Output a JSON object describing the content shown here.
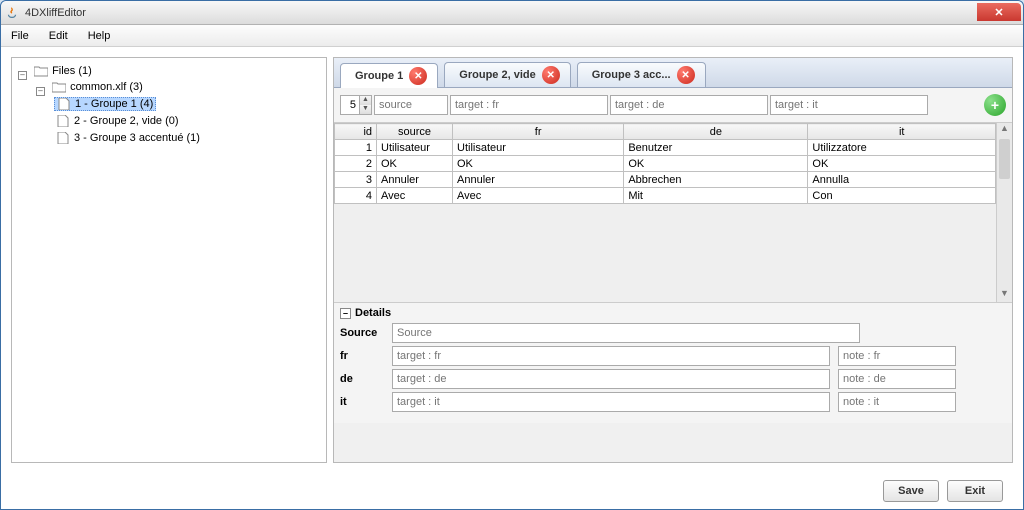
{
  "window": {
    "title": "4DXliffEditor"
  },
  "menu": {
    "file": "File",
    "edit": "Edit",
    "help": "Help"
  },
  "tree": {
    "root": "Files (1)",
    "file": "common.xlf (3)",
    "items": [
      "1 - Groupe 1 (4)",
      "2 - Groupe 2, vide (0)",
      "3 - Groupe 3 accentué (1)"
    ]
  },
  "tabs": [
    {
      "label": "Groupe 1"
    },
    {
      "label": "Groupe 2, vide"
    },
    {
      "label": "Groupe 3 acc..."
    }
  ],
  "inputRow": {
    "spinner": "5",
    "placeholders": {
      "source": "source",
      "fr": "target : fr",
      "de": "target : de",
      "it": "target : it"
    }
  },
  "grid": {
    "headers": {
      "id": "id",
      "source": "source",
      "fr": "fr",
      "de": "de",
      "it": "it"
    },
    "rows": [
      {
        "id": "1",
        "source": "Utilisateur",
        "fr": "Utilisateur",
        "de": "Benutzer",
        "it": "Utilizzatore"
      },
      {
        "id": "2",
        "source": "OK",
        "fr": "OK",
        "de": "OK",
        "it": "OK"
      },
      {
        "id": "3",
        "source": "Annuler",
        "fr": "Annuler",
        "de": "Abbrechen",
        "it": "Annulla"
      },
      {
        "id": "4",
        "source": "Avec",
        "fr": "Avec",
        "de": "Mit",
        "it": "Con"
      }
    ]
  },
  "details": {
    "header": "Details",
    "labels": {
      "source": "Source",
      "fr": "fr",
      "de": "de",
      "it": "it"
    },
    "placeholders": {
      "source": "Source",
      "fr_target": "target : fr",
      "fr_note": "note : fr",
      "de_target": "target : de",
      "de_note": "note : de",
      "it_target": "target : it",
      "it_note": "note : it"
    }
  },
  "footer": {
    "save": "Save",
    "exit": "Exit"
  }
}
